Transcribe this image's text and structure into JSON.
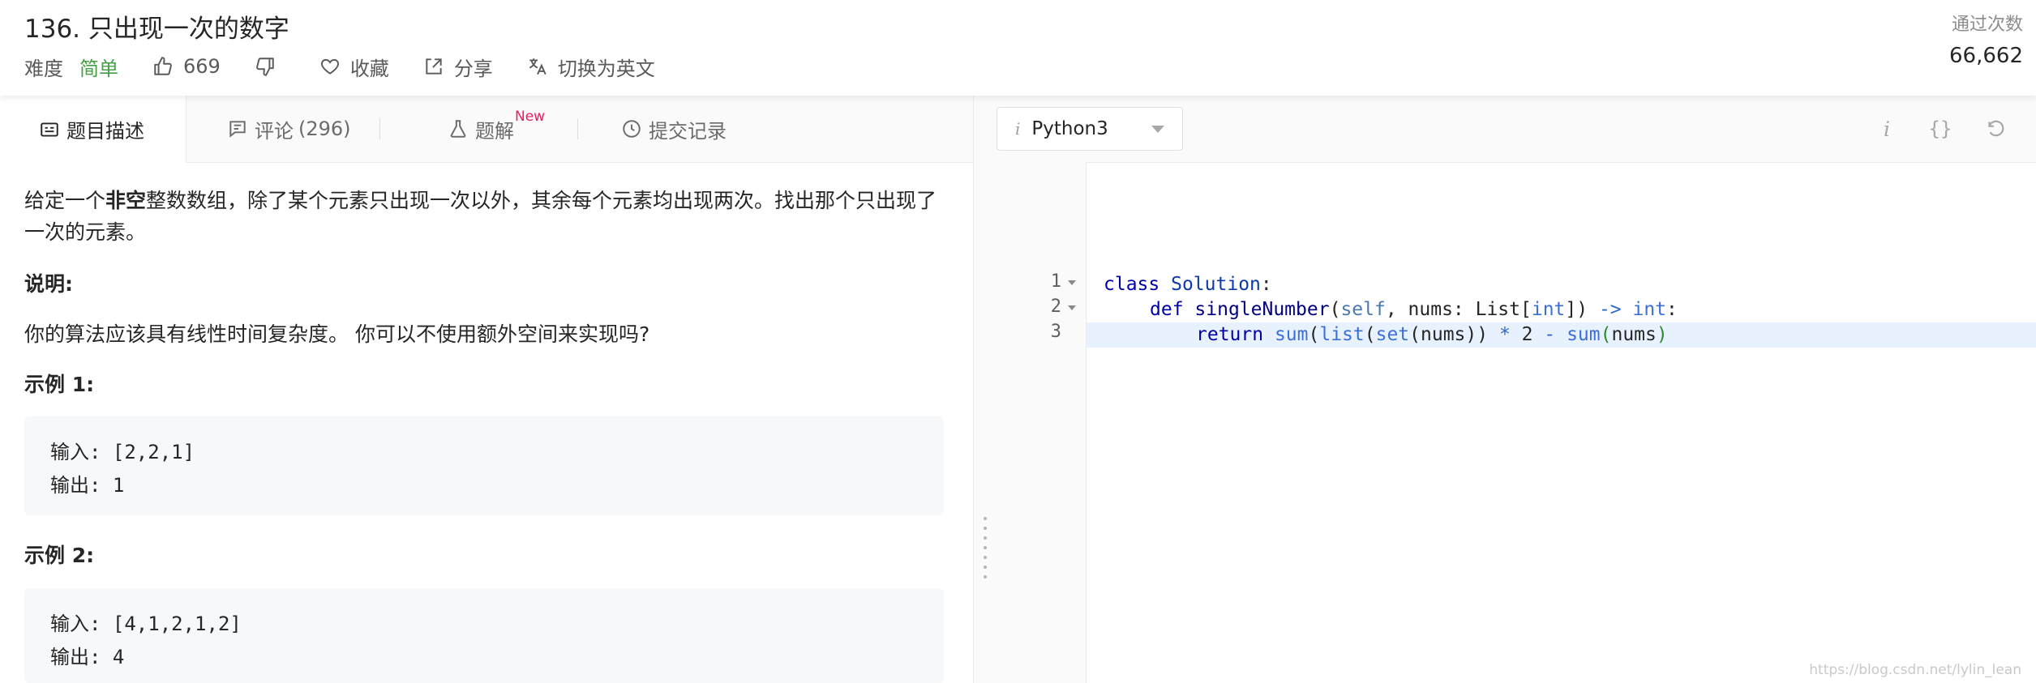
{
  "header": {
    "title": "136. 只出现一次的数字",
    "difficulty_label": "难度",
    "difficulty_value": "简单",
    "like_count": "669",
    "collect_label": "收藏",
    "share_label": "分享",
    "switch_lang_label": "切换为英文",
    "stat_label": "通过次数",
    "stat_value": "66,662"
  },
  "tabs": {
    "description": "题目描述",
    "comments_label": "评论",
    "comments_count": "(296)",
    "solutions": "题解",
    "new_badge": "New",
    "submissions": "提交记录"
  },
  "problem": {
    "desc_pre": "给定一个",
    "desc_bold": "非空",
    "desc_post": "整数数组，除了某个元素只出现一次以外，其余每个元素均出现两次。找出那个只出现了一次的元素。",
    "note_heading": "说明:",
    "note_text": "你的算法应该具有线性时间复杂度。 你可以不使用额外空间来实现吗?",
    "examples": [
      {
        "heading": "示例 1:",
        "input": "输入: [2,2,1]",
        "output": "输出: 1"
      },
      {
        "heading": "示例 2:",
        "input": "输入: [4,1,2,1,2]",
        "output": "输出: 4"
      }
    ]
  },
  "editor": {
    "language": "Python3",
    "info_icon": "i",
    "format_icon": "{}",
    "line_numbers": [
      "1",
      "2",
      "3"
    ],
    "code": {
      "l1": {
        "kw": "class",
        "name": "Solution",
        "colon": ":"
      },
      "l2": {
        "kw": "def",
        "name": "singleNumber",
        "p1": "(",
        "self": "self",
        "p2": ", nums: List[",
        "t1": "int",
        "p3": "]) ",
        "arrow": "->",
        "sp": " ",
        "t2": "int",
        "colon": ":"
      },
      "l3": {
        "kw": "return",
        "f1": "sum",
        "p1": "(",
        "f2": "list",
        "p2": "(",
        "f3": "set",
        "p3": "(nums)) ",
        "op1": "*",
        "two": " 2 ",
        "op2": "-",
        "sp": " ",
        "f4": "sum",
        "p4": "(",
        "arg": "nums",
        "p5": ")"
      }
    }
  },
  "watermark": "https://blog.csdn.net/lylin_lean"
}
